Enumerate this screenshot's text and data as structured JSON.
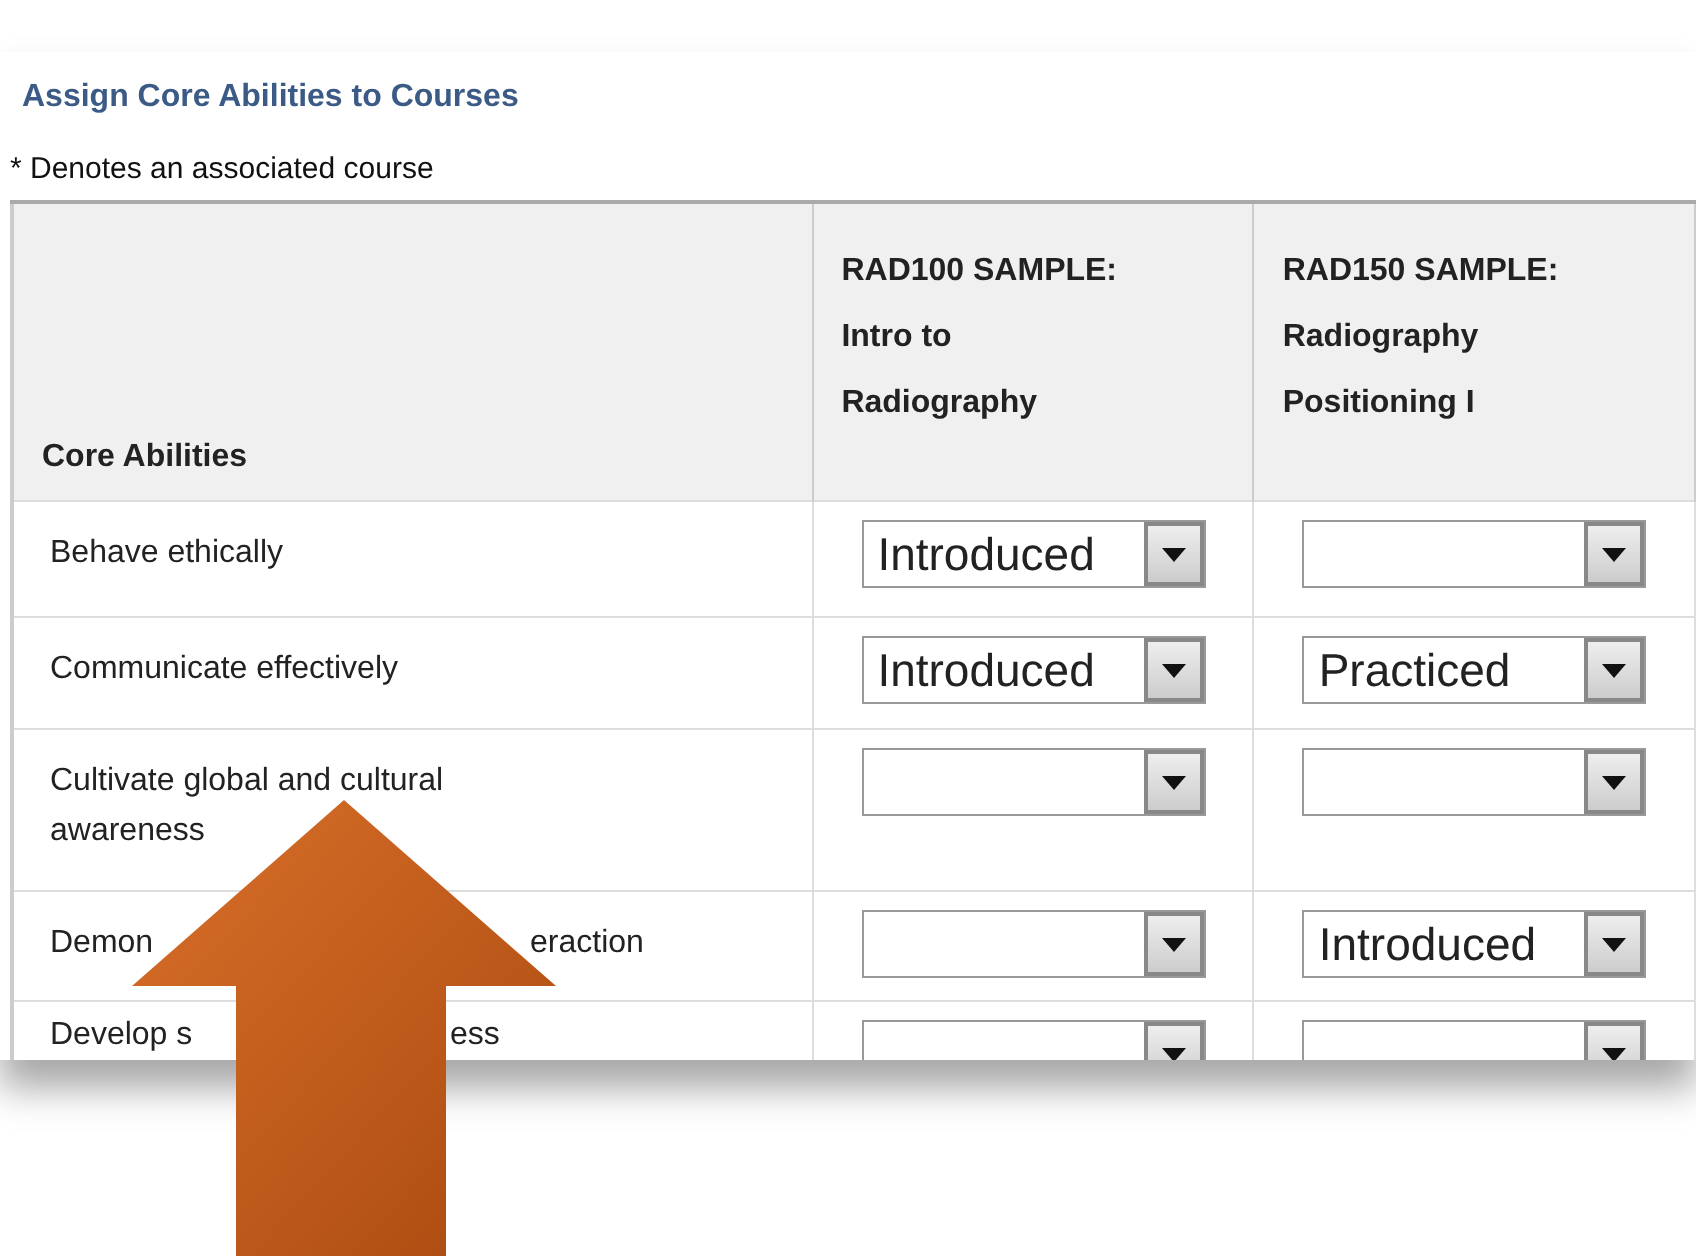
{
  "title": "Assign Core Abilities to Courses",
  "note": "* Denotes an associated course",
  "table": {
    "columns": [
      {
        "label": "Core Abilities"
      },
      {
        "label_lines": [
          "RAD100 SAMPLE:",
          "Intro to",
          "Radiography"
        ]
      },
      {
        "label_lines": [
          "RAD150 SAMPLE:",
          "Radiography",
          "Positioning I"
        ]
      }
    ],
    "rows": [
      {
        "cells": [
          {
            "kind": "label",
            "parts": [
              "Behave ethically"
            ]
          },
          {
            "kind": "dropdown",
            "value": "Introduced"
          },
          {
            "kind": "dropdown"
          }
        ]
      },
      {
        "cells": [
          {
            "kind": "label",
            "parts": [
              "Communicate effectively"
            ]
          },
          {
            "kind": "dropdown",
            "value": "Introduced"
          },
          {
            "kind": "dropdown",
            "value": "Practiced"
          }
        ]
      },
      {
        "cells": [
          {
            "kind": "label",
            "parts": [
              "Cultivate global and cultural awareness"
            ]
          },
          {
            "kind": "dropdown"
          },
          {
            "kind": "dropdown"
          }
        ]
      },
      {
        "cells": [
          {
            "kind": "label",
            "parts": [
              "Demon",
              "eraction"
            ]
          },
          {
            "kind": "dropdown"
          },
          {
            "kind": "dropdown",
            "value": "Introduced"
          }
        ]
      },
      {
        "cells": [
          {
            "kind": "label",
            "parts": [
              "Develop s",
              "ess"
            ]
          },
          {
            "kind": "dropdown"
          },
          {
            "kind": "dropdown"
          }
        ]
      }
    ]
  }
}
